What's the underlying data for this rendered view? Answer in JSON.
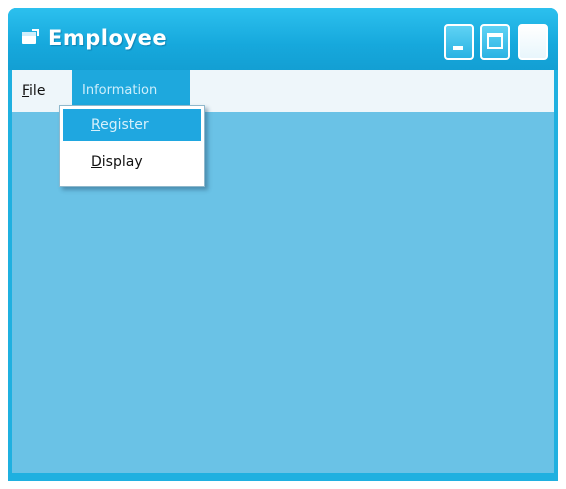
{
  "window": {
    "title": "Employee",
    "icon": "app-window-icon"
  },
  "titlebar_buttons": [
    "minimize-icon",
    "maximize-icon",
    "close-icon"
  ],
  "menubar": {
    "items": [
      {
        "label": "File",
        "mnemonic": "F",
        "rest": "ile"
      },
      {
        "label": "Information"
      }
    ]
  },
  "dropdown": {
    "items": [
      {
        "label": "Register",
        "mnemonic": "R",
        "rest": "egister",
        "highlighted": true
      },
      {
        "label": "Display",
        "mnemonic": "D",
        "rest": "isplay",
        "highlighted": false
      }
    ]
  },
  "colors": {
    "titlebar": "#16a8dc",
    "client_area": "#6ac2e6",
    "menu_highlight": "#1fa7e0"
  }
}
